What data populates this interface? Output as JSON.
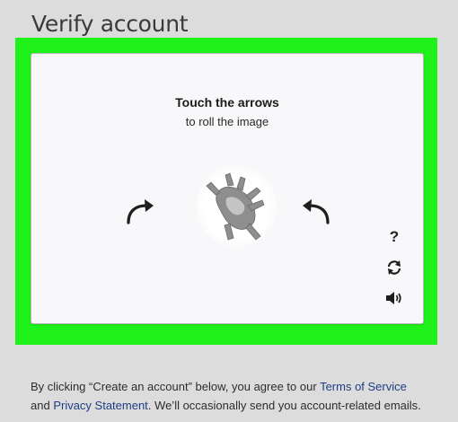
{
  "header": {
    "title": "Verify account"
  },
  "captcha": {
    "instruction_title": "Touch the arrows",
    "instruction_sub": "to roll the image",
    "image_subject": "rotated-animal-image",
    "help_label": "?",
    "icons": [
      "rotate-left-arrow-icon",
      "rotate-right-arrow-icon",
      "help-icon",
      "refresh-icon",
      "audio-icon"
    ]
  },
  "footer": {
    "text_before": "By clicking “Create an account” below, you agree to our ",
    "terms_link": "Terms of Service",
    "text_and": " and ",
    "privacy_link": "Privacy Statement",
    "text_after": ". We’ll occasionally send you account-related emails."
  },
  "colors": {
    "highlight": "#1ef21a",
    "link": "#1f3f85",
    "background": "#dcdcdc"
  }
}
